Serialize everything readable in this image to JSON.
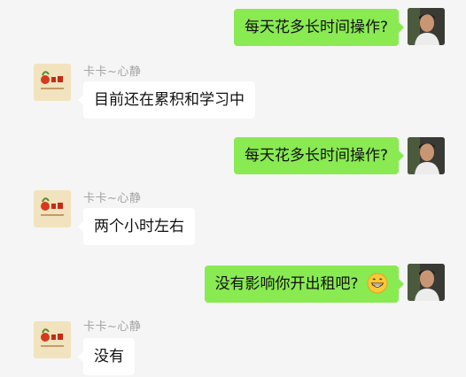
{
  "sender_name": "卡卡~心静",
  "messages": [
    {
      "from": "me",
      "text": "每天花多长时间操作?"
    },
    {
      "from": "other",
      "text": "目前还在累积和学习中"
    },
    {
      "from": "me",
      "text": "每天花多长时间操作?"
    },
    {
      "from": "other",
      "text": "两个小时左右"
    },
    {
      "from": "me",
      "text": "没有影响你开出租吧?",
      "emoji": "grinning-face-emoji"
    },
    {
      "from": "other",
      "text": "没有"
    }
  ]
}
